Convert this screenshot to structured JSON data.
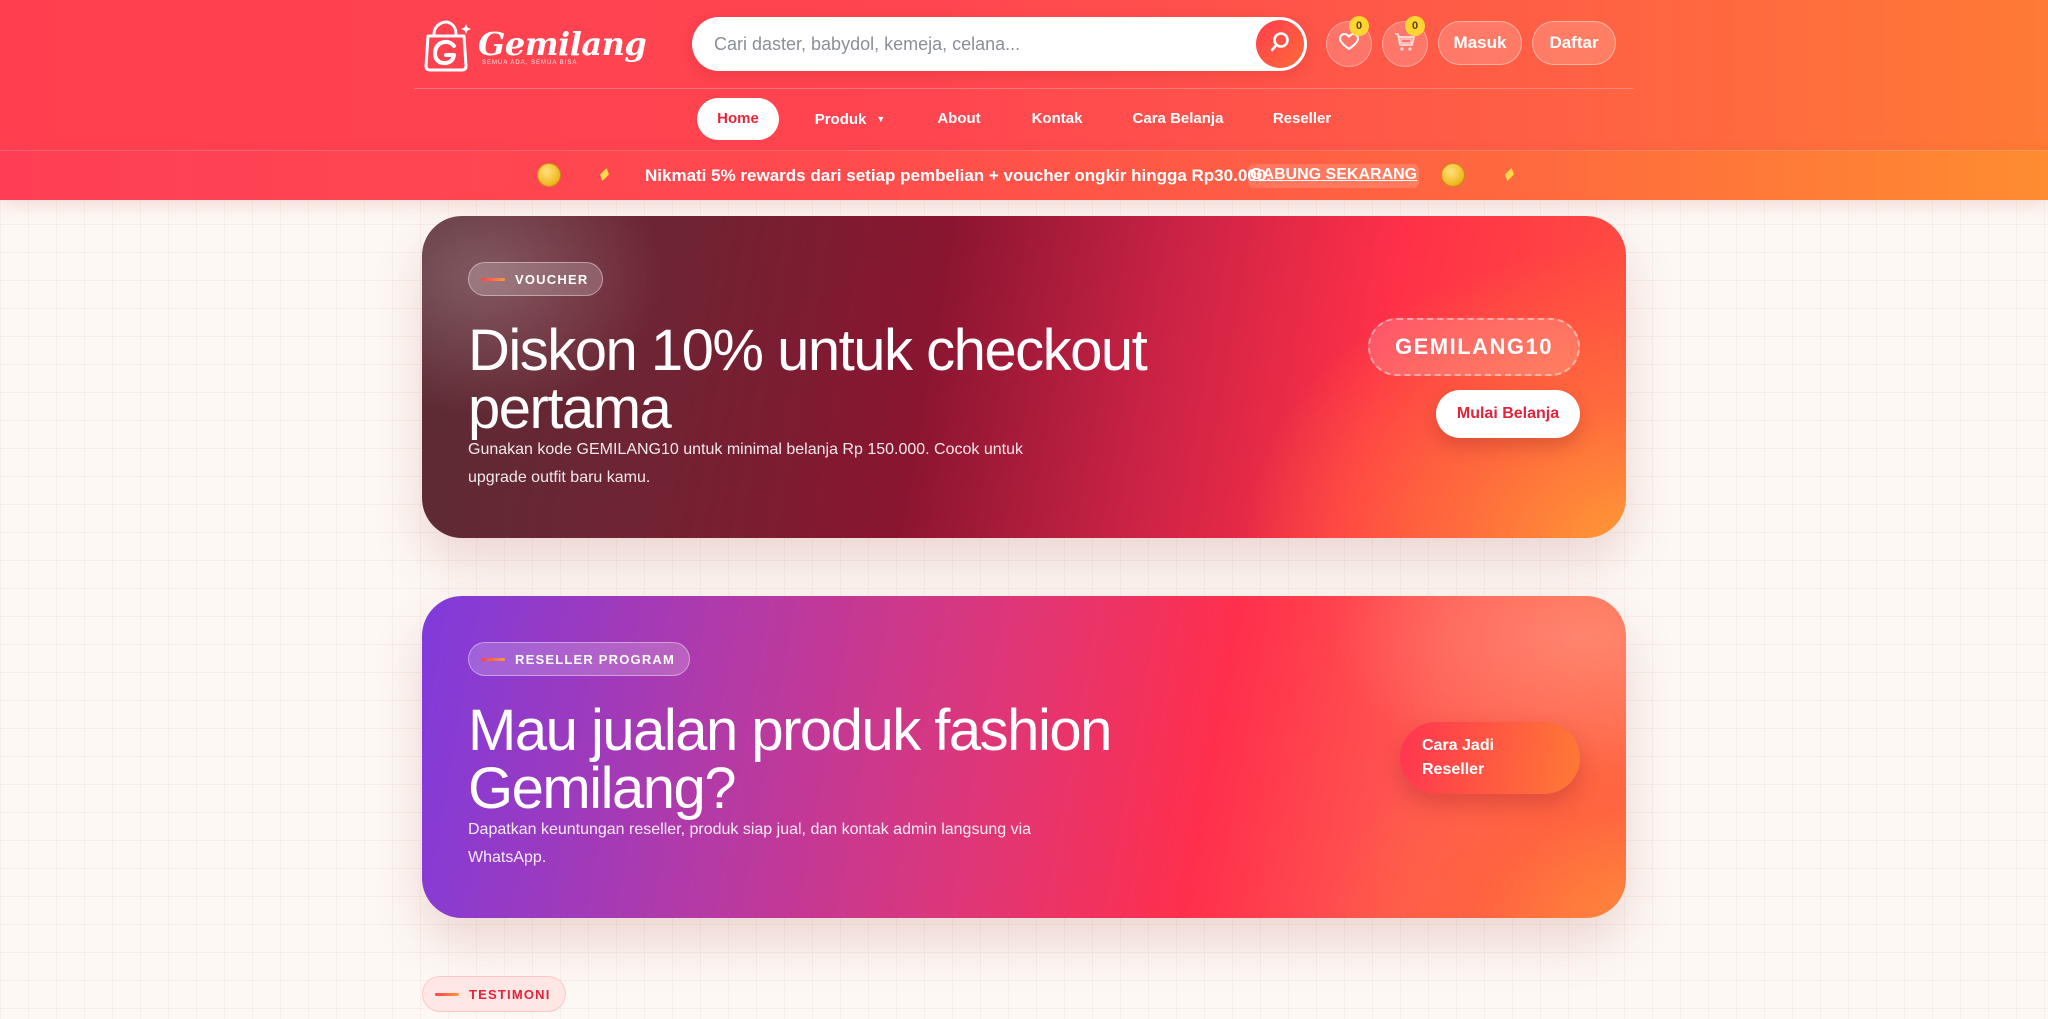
{
  "brand": {
    "name": "Gemilang",
    "tagline": "SEMUA ADA, SEMUA BISA"
  },
  "search": {
    "placeholder": "Cari daster, babydol, kemeja, celana..."
  },
  "header": {
    "wishlist_count": "0",
    "cart_count": "0",
    "login_label": "Masuk",
    "register_label": "Daftar"
  },
  "nav": {
    "items": [
      {
        "label": "Home",
        "active": true
      },
      {
        "label": "Produk",
        "active": false,
        "has_dropdown": true
      },
      {
        "label": "About",
        "active": false
      },
      {
        "label": "Kontak",
        "active": false
      },
      {
        "label": "Cara Belanja",
        "active": false
      },
      {
        "label": "Reseller",
        "active": false
      }
    ]
  },
  "promo": {
    "text": "Nikmati 5% rewards dari setiap pembelian + voucher ongkir hingga Rp30.000.",
    "link_label": "GABUNG SEKARANG"
  },
  "voucher_banner": {
    "tag": "VOUCHER",
    "title": "Diskon 10% untuk checkout pertama",
    "description": "Gunakan kode GEMILANG10 untuk minimal belanja Rp 150.000. Cocok untuk upgrade outfit baru kamu.",
    "code": "GEMILANG10",
    "cta_label": "Mulai Belanja"
  },
  "reseller_banner": {
    "tag": "RESELLER PROGRAM",
    "title": "Mau jualan produk fashion Gemilang?",
    "description": "Dapatkan keuntungan reseller, produk siap jual, dan kontak admin langsung via WhatsApp.",
    "cta_label": "Cara Jadi Reseller"
  },
  "testimoni": {
    "tag": "TESTIMONI"
  },
  "colors": {
    "primary": "#ff3f4f",
    "accent_orange": "#ff7a35",
    "coin_gold": "#f1b51f",
    "badge_yellow": "#ffd531",
    "cta_text_red": "#e3223c"
  },
  "icons": [
    "shopping-bag-logo-icon",
    "search-icon",
    "heart-icon",
    "cart-icon",
    "caret-down-icon",
    "coin-icon",
    "spark-icon"
  ]
}
